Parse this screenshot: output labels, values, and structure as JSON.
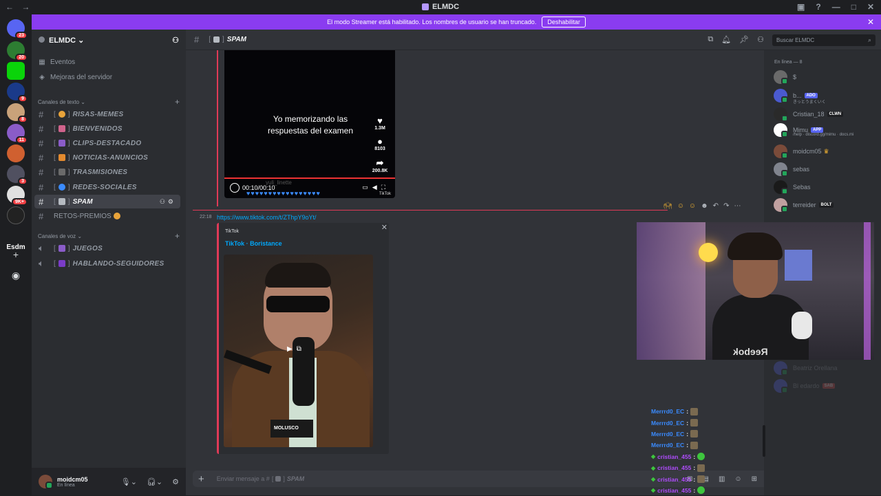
{
  "window": {
    "title": "ELMDC"
  },
  "banner": {
    "text": "El modo Streamer está habilitado. Los nombres de usuario se han truncado.",
    "button": "Deshabilitar"
  },
  "server_rail": {
    "badges": [
      "23",
      "20",
      "9",
      "8",
      "11",
      "3",
      "9K+"
    ],
    "text_server": "Esdm"
  },
  "sidebar": {
    "server_name": "ELMDC",
    "items": [
      {
        "icon": "calendar-icon",
        "label": "Eventos"
      },
      {
        "icon": "boost-icon",
        "label": "Mejoras del servidor"
      }
    ],
    "text_category": "Canales de texto",
    "text_channels": [
      {
        "name": "RISAS-MEMES",
        "color": "#e8a33a"
      },
      {
        "name": "BIENVENIDOS",
        "color": "#d0638c"
      },
      {
        "name": "CLIPS-DESTACADO",
        "color": "#8a5cc8"
      },
      {
        "name": "NOTICIAS-ANUNCIOS",
        "color": "#e38a2f"
      },
      {
        "name": "TRASMISIONES",
        "color": "#6a6a6a"
      },
      {
        "name": "REDES-SOCIALES",
        "color": "#3a8bff"
      },
      {
        "name": "SPAM",
        "color": "#b5bac1"
      }
    ],
    "plain_channel": "RETOS-PREMIOS",
    "voice_category": "Canales de voz",
    "voice_channels": [
      {
        "name": "JUEGOS",
        "color": "#8a5cc8"
      },
      {
        "name": "HABLANDO-SEGUIDORES",
        "color": "#7a3cc8"
      }
    ]
  },
  "user": {
    "name": "moidcm05",
    "status": "En línea"
  },
  "channel_header": {
    "name": "SPAM",
    "search_placeholder": "Buscar ELMDC"
  },
  "video": {
    "caption": "Yo memorizando las respuestas del examen",
    "likes": "1.3M",
    "comments": "8103",
    "shares": "200.8K",
    "time": "00:10/00:10",
    "watermark": "yuli_linette",
    "brand": "TikTok",
    "progress": 1.0
  },
  "message": {
    "time": "22:18",
    "link": "https://www.tiktok.com/t/ZThpY9oYt/",
    "embed_provider": "TikTok",
    "embed_author": "TikTok · Boristance",
    "thumb_sign": "MOLUSCO"
  },
  "composer": {
    "placeholder": "Enviar mensaje a #",
    "channel": "SPAM"
  },
  "members": {
    "header": "En línea — 8",
    "list": [
      {
        "name": "$",
        "sub": "",
        "tag": "",
        "color": "#6a6a6a"
      },
      {
        "name": "b...",
        "sub": "きっとうまくいく",
        "tag": "ADO",
        "color": "#4a5ad0"
      },
      {
        "name": "Cristian_18",
        "sub": "",
        "tag": "CLWN",
        "color": "#2a2a2a"
      },
      {
        "name": "Mimu",
        "sub": "/help · discord.gg/mimu · docs.mi",
        "tag": "APP",
        "color": "#ffffff"
      },
      {
        "name": "moidcm05",
        "sub": "",
        "tag": "",
        "color": "#7a4b3a"
      },
      {
        "name": "sebas",
        "sub": "",
        "tag": "",
        "color": "#80848e"
      },
      {
        "name": "Sebas",
        "sub": "",
        "tag": "",
        "color": "#1a1a1a"
      },
      {
        "name": "terreider",
        "sub": "",
        "tag": "BOLT",
        "color": "#c0a0a0"
      }
    ],
    "offline": [
      {
        "name": "Beatriz Orellana",
        "tag": ""
      },
      {
        "name": "Bl edardo",
        "tag": "SAB"
      }
    ]
  },
  "stream_chat": [
    {
      "user": "Merrrd0_EC",
      "kind": "blue"
    },
    {
      "user": "Merrrd0_EC",
      "kind": "blue"
    },
    {
      "user": "Merrrd0_EC",
      "kind": "blue"
    },
    {
      "user": "Merrrd0_EC",
      "kind": "blue"
    },
    {
      "user": "cristian_455",
      "kind": "purple"
    },
    {
      "user": "cristian_455",
      "kind": "purple"
    },
    {
      "user": "cristian_455",
      "kind": "purple"
    },
    {
      "user": "cristian_455",
      "kind": "purple"
    }
  ],
  "webcam": {
    "shirt_logo": "Reebok"
  }
}
